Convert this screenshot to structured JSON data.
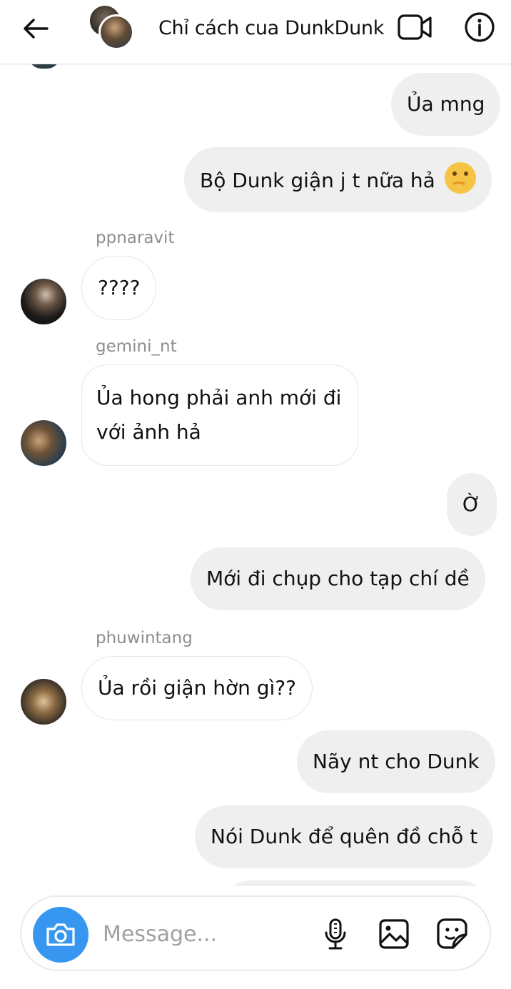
{
  "header": {
    "title": "Chỉ cách cua DunkDunk",
    "back_icon": "arrow-left-icon",
    "video_icon": "video-camera-icon",
    "info_icon": "info-icon"
  },
  "messages": [
    {
      "type": "out",
      "text": "Ủa mng"
    },
    {
      "type": "out",
      "text": "Bộ Dunk giận j t nữa hả",
      "emoji": "thinking-face-emoji"
    },
    {
      "type": "in",
      "sender": "ppnaravit",
      "text": "????"
    },
    {
      "type": "in",
      "sender": "gemini_nt",
      "text": "Ủa hong phải anh mới đi với ảnh hả"
    },
    {
      "type": "out",
      "text": "Ờ"
    },
    {
      "type": "out",
      "text": "Mới đi chụp cho tạp chí dề"
    },
    {
      "type": "in",
      "sender": "phuwintang",
      "text": "Ủa rồi giận hờn gì??"
    },
    {
      "type": "out",
      "text": "Nãy nt cho Dunk"
    },
    {
      "type": "out",
      "text": "Nói Dunk để quên đồ chỗ t"
    }
  ],
  "composer": {
    "placeholder": "Message...",
    "camera_icon": "camera-icon",
    "mic_icon": "microphone-icon",
    "gallery_icon": "image-icon",
    "sticker_icon": "sticker-icon"
  },
  "colors": {
    "accent": "#3797f0",
    "outgoing_bubble": "#efefef",
    "sender_name": "#8e8e8e"
  }
}
